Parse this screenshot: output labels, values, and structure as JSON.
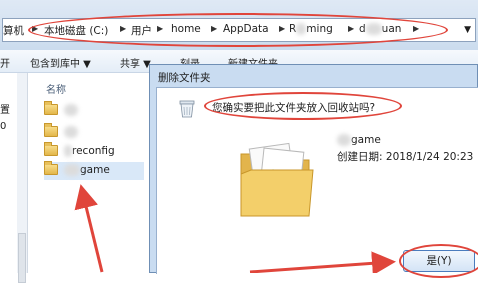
{
  "address_bar": {
    "crumbs": [
      "算机",
      "本地磁盘 (C:)",
      "用户",
      "home",
      "AppData",
      "R",
      "ming",
      "d",
      "uan"
    ],
    "dropdown_icon": "chevron-down-icon"
  },
  "toolbar": {
    "organize_partial": "开",
    "include_in_library": "包含到库中 ▼",
    "share": "共享 ▼",
    "burn": "刻录",
    "new_folder": "新建文件夹"
  },
  "nav_pane": {
    "items": [
      "置",
      "0"
    ]
  },
  "file_list": {
    "column_name": "名称",
    "items": [
      {
        "label": "",
        "blurred": true
      },
      {
        "label": "",
        "blurred": true
      },
      {
        "label": "reconfig",
        "blurred": true
      },
      {
        "label": "game",
        "blurred": true
      }
    ]
  },
  "dialog": {
    "title": "删除文件夹",
    "question": "您确实要把此文件夹放入回收站吗?",
    "file_name": "game",
    "created_label": "创建日期:",
    "created_value": "2018/1/24 20:23",
    "yes_button": "是(Y)"
  },
  "colors": {
    "annotation_red": "#e0453b",
    "dialog_frame": "#c9dcf1",
    "address_bar": "#dfe9f5"
  }
}
